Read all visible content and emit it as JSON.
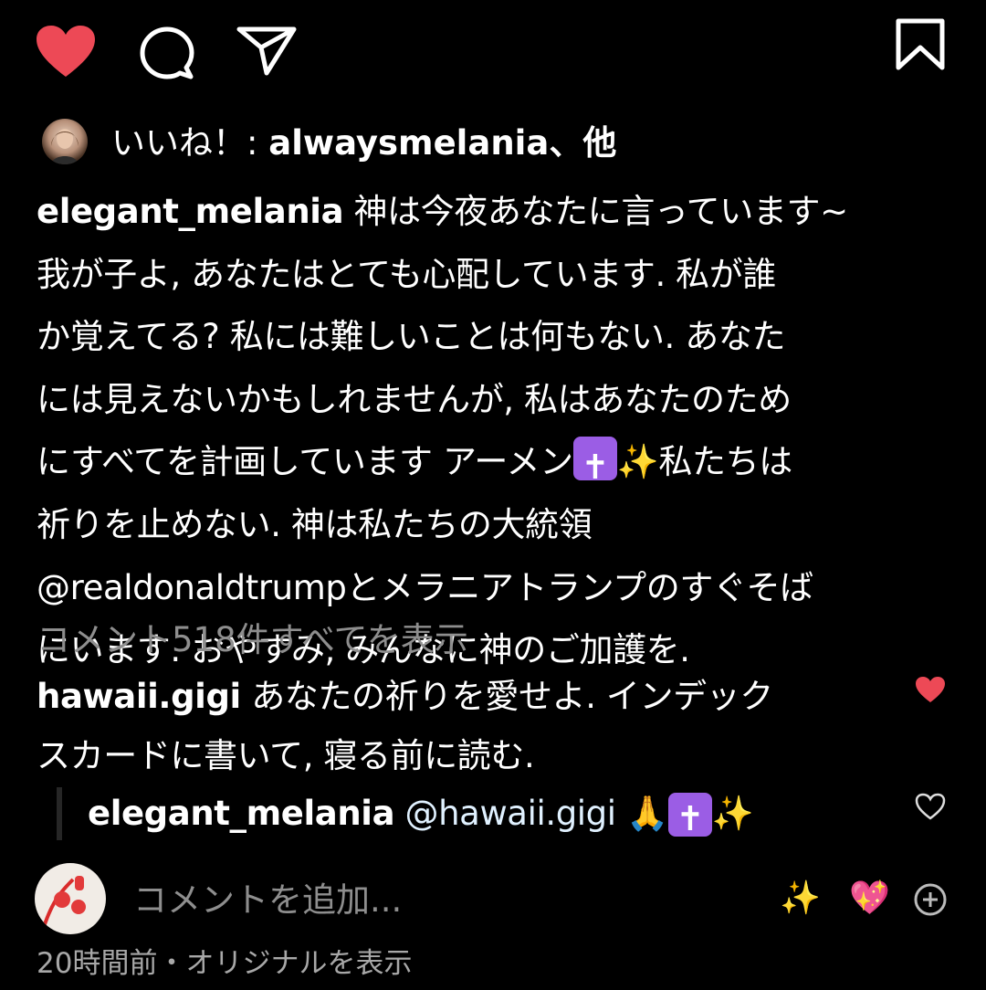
{
  "actions": {
    "like_icon": "heart-filled-icon",
    "comment_icon": "speech-bubble-icon",
    "share_icon": "paper-plane-icon",
    "save_icon": "bookmark-icon",
    "like_color": "#ed4956"
  },
  "likes": {
    "prefix": "いいね！: ",
    "user": "alwaysmelania",
    "suffix": "、他"
  },
  "caption": {
    "username": "elegant_melania",
    "line1": " 神は今夜あなたに言っています~",
    "line2": "我が子よ, あなたはとても心配しています. 私が誰",
    "line3": "か覚えてる? 私には難しいことは何もない. あなた",
    "line4": "には見えないかもしれませんが, 私はあなたのため",
    "line5_a": "にすべてを計画しています アーメン",
    "cross_emoji": "✝",
    "sparkles_emoji": "✨",
    "line5_b": "私たちは",
    "line6": "祈りを止めない. 神は私たちの大統領",
    "line7": "@realdonaldtrumpとメラニアトランプのすぐそば",
    "line8": "にいます. おやすみ, みんなに神のご加護を."
  },
  "view_comments": "コメント518件すべてを表示",
  "comment": {
    "username": "hawaii.gigi",
    "line1": " あなたの祈りを愛せよ. インデック",
    "line2": "スカードに書いて, 寝る前に読む."
  },
  "reply": {
    "username": "elegant_melania",
    "mention": " @hawaii.gigi",
    "pray_emoji": "🙏",
    "cross_emoji": "✝",
    "sparkles_emoji": "✨"
  },
  "add_comment": {
    "placeholder": "コメントを追加...",
    "emoji_1": "✨",
    "emoji_2": "💖",
    "add_icon": "plus-circle-icon"
  },
  "footer": "20時間前・オリジナルを表示"
}
